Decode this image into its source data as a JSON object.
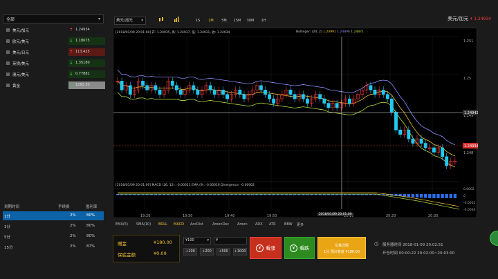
{
  "category": {
    "selected": "全部"
  },
  "pairs": [
    {
      "name": "美元/加元",
      "price": "1.24934",
      "dir": "up",
      "bg": "#1a1a1a"
    },
    {
      "name": "欧元/美元",
      "price": "1.18675",
      "dir": "down",
      "bg": "#153314"
    },
    {
      "name": "美元/日元",
      "price": "113.425",
      "dir": "up",
      "bg": "#5b1a14"
    },
    {
      "name": "英镑/美元",
      "price": "1.35180",
      "dir": "down",
      "bg": "#153314"
    },
    {
      "name": "澳元/美元",
      "price": "0.77881",
      "dir": "down",
      "bg": "#153314"
    },
    {
      "name": "黄金",
      "price": "1282.30",
      "dir": "down",
      "bg": "#8a8a8a"
    }
  ],
  "history": {
    "headers": [
      "到期时间",
      "手续费",
      "盈利率"
    ],
    "rows": [
      {
        "time": "1分",
        "fee": "2%",
        "rate": "80%",
        "selected": true
      },
      {
        "time": "3分",
        "fee": "2%",
        "rate": "80%",
        "selected": false
      },
      {
        "time": "5分",
        "fee": "2%",
        "rate": "80%",
        "selected": false
      },
      {
        "time": "15分",
        "fee": "2%",
        "rate": "87%",
        "selected": false
      }
    ]
  },
  "toolbar": {
    "pair": "美元/加元",
    "timeframes": [
      "1S",
      "1M",
      "5M",
      "15M",
      "30M",
      "1H"
    ],
    "active_timeframe": "1M"
  },
  "header_quote": {
    "pair": "美元/加元",
    "price": "1.24934"
  },
  "chart_data": {
    "type": "candlestick",
    "title": "[2018/01/09 20:01:00] 开: 1.24935, 高: 1.24937, 低: 1.24931, 收: 1.24934",
    "legend": [
      "Bollinger: (20, 2)",
      "1.24991",
      "1.24896",
      "1.24871"
    ],
    "y_ticks": [
      "1.251",
      "1.25",
      "1.249",
      "1.248"
    ],
    "x_ticks": [
      "19:20",
      "19:30",
      "19:40",
      "19:50",
      "20:10",
      "20:20",
      "20:30"
    ],
    "crosshair_price": "1.24942",
    "current_price": "1.24934",
    "crosshair_time": "2018/01/09 20:01:00",
    "macd_title": "[2018/01/09 20:01:00] MACD (26, 12): -0.00011 EMA (9): -0.00016 Divergence: -0.00002",
    "macd_ticks": [
      "0.0002",
      "0",
      "-0.0002",
      "-0.0004"
    ],
    "series": [
      {
        "name": "close",
        "values": [
          1.2502,
          1.25,
          1.2501,
          1.2499,
          1.25,
          1.2502,
          1.2501,
          1.25,
          1.2501,
          1.25,
          1.2499,
          1.25,
          1.2502,
          1.2501,
          1.25,
          1.2499,
          1.25,
          1.2501,
          1.25,
          1.2499,
          1.25,
          1.2501,
          1.25,
          1.2499,
          1.25,
          1.2499,
          1.2498,
          1.2499,
          1.25,
          1.2499,
          1.2498,
          1.2499,
          1.25,
          1.2501,
          1.25,
          1.2499,
          1.2498,
          1.2497,
          1.2498,
          1.2499,
          1.25,
          1.2499,
          1.2498,
          1.2499,
          1.2498,
          1.2497,
          1.2498,
          1.2499,
          1.2498,
          1.2497,
          1.2496,
          1.2497,
          1.2496,
          1.2497,
          1.2498,
          1.2497,
          1.2498,
          1.2499,
          1.25,
          1.2501,
          1.25,
          1.2499,
          1.25,
          1.2499,
          1.2498,
          1.2495,
          1.2491,
          1.249,
          1.2491,
          1.2489,
          1.2488,
          1.2489,
          1.2488,
          1.2487,
          1.2487,
          1.2486,
          1.2487,
          1.2485,
          1.2483,
          1.2484,
          1.2484
        ]
      }
    ]
  },
  "indicators": [
    "EMA(5)",
    "SMA(10)",
    "BOLL",
    "MACD",
    "AccDist",
    "AroonOsc",
    "Aroon",
    "ADX",
    "ATR",
    "BBW",
    "更多"
  ],
  "active_indicators": [
    "BOLL",
    "MACD"
  ],
  "balance": {
    "label1": "赠金",
    "val1": "¥180.00",
    "label2": "保底金额",
    "val2": "¥0.00"
  },
  "amount": {
    "field1": "¥100",
    "field2": "¥",
    "quick": [
      "+100",
      "+200",
      "+500",
      "+1000"
    ]
  },
  "actions": {
    "up": "看涨",
    "down": "看跌",
    "submit_line1": "交易详情",
    "submit_line2": "1分 预计收益 ¥180.00"
  },
  "server": {
    "label": "服务器时间",
    "time": "2018-01-09 20:02:51",
    "remain_label": "开仓时间",
    "remain": "00:00:22  20:02:00~20:03:00"
  }
}
